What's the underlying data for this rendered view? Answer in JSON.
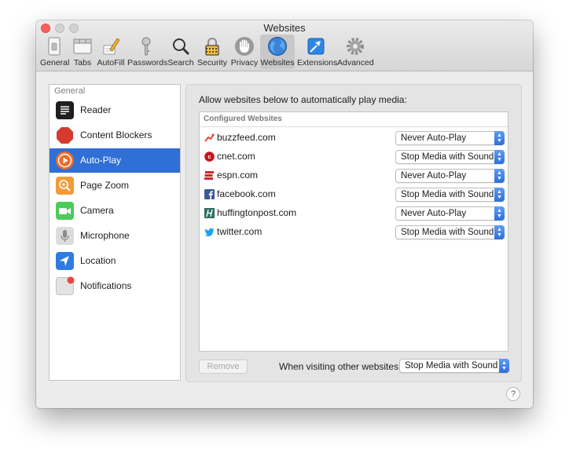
{
  "window": {
    "title": "Websites"
  },
  "toolbar": {
    "items": [
      {
        "label": "General",
        "icon": "general-switch-icon"
      },
      {
        "label": "Tabs",
        "icon": "tabs-icon"
      },
      {
        "label": "AutoFill",
        "icon": "autofill-pencil-icon"
      },
      {
        "label": "Passwords",
        "icon": "key-icon"
      },
      {
        "label": "Search",
        "icon": "magnifier-icon"
      },
      {
        "label": "Security",
        "icon": "padlock-icon"
      },
      {
        "label": "Privacy",
        "icon": "hand-icon"
      },
      {
        "label": "Websites",
        "icon": "globe-icon",
        "selected": true
      },
      {
        "label": "Extensions",
        "icon": "extensions-icon"
      },
      {
        "label": "Advanced",
        "icon": "gear-icon"
      }
    ]
  },
  "sidebar": {
    "header": "General",
    "items": [
      {
        "label": "Reader",
        "icon": "reader-icon"
      },
      {
        "label": "Content Blockers",
        "icon": "stop-sign-icon"
      },
      {
        "label": "Auto-Play",
        "icon": "play-icon",
        "selected": true
      },
      {
        "label": "Page Zoom",
        "icon": "zoom-icon"
      },
      {
        "label": "Camera",
        "icon": "camera-icon"
      },
      {
        "label": "Microphone",
        "icon": "microphone-icon"
      },
      {
        "label": "Location",
        "icon": "location-arrow-icon"
      },
      {
        "label": "Notifications",
        "icon": "notifications-icon"
      }
    ]
  },
  "main": {
    "instruction": "Allow websites below to automatically play media:",
    "table_header": "Configured Websites",
    "rows": [
      {
        "site": "buzzfeed.com",
        "setting": "Never Auto-Play",
        "icon": "buzzfeed-icon"
      },
      {
        "site": "cnet.com",
        "setting": "Stop Media with Sound",
        "icon": "cnet-icon"
      },
      {
        "site": "espn.com",
        "setting": "Never Auto-Play",
        "icon": "espn-icon"
      },
      {
        "site": "facebook.com",
        "setting": "Stop Media with Sound",
        "icon": "facebook-icon"
      },
      {
        "site": "huffingtonpost.com",
        "setting": "Never Auto-Play",
        "icon": "huffingtonpost-icon"
      },
      {
        "site": "twitter.com",
        "setting": "Stop Media with Sound",
        "icon": "twitter-icon"
      }
    ],
    "remove_label": "Remove",
    "other_label": "When visiting other websites:",
    "other_setting": "Stop Media with Sound",
    "help_label": "?"
  },
  "colors": {
    "accent": "#2f6fd6",
    "traffic_close": "#fc605c",
    "buzzfeed": "#ee3322",
    "cnet": "#c4151c",
    "espn": "#d22630",
    "facebook": "#3b5998",
    "huffingtonpost": "#2e7061",
    "twitter": "#1da1f2"
  }
}
